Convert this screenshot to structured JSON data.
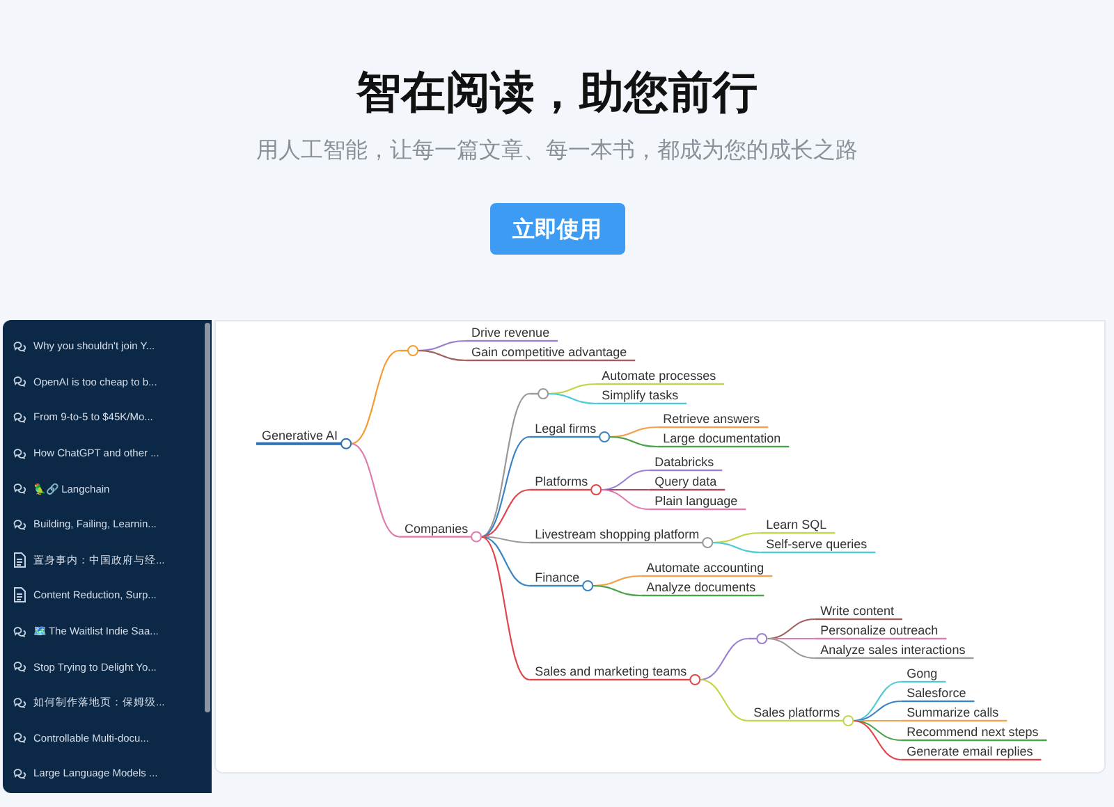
{
  "hero": {
    "title": "智在阅读，助您前行",
    "subtitle": "用人工智能，让每一篇文章、每一本书，都成为您的成长之路",
    "button": "立即使用"
  },
  "sidebar": {
    "items": [
      {
        "kind": "chat",
        "title": "Why you shouldn't join Y..."
      },
      {
        "kind": "chat",
        "title": "OpenAI is too cheap to b..."
      },
      {
        "kind": "chat",
        "title": "From 9-to-5 to $45K/Mo..."
      },
      {
        "kind": "chat",
        "title": "How ChatGPT and other ..."
      },
      {
        "kind": "chat",
        "title": "🦜🔗 Langchain"
      },
      {
        "kind": "chat",
        "title": "Building, Failing, Learnin..."
      },
      {
        "kind": "document",
        "title": "置身事内：中国政府与经..."
      },
      {
        "kind": "document",
        "title": "Content Reduction, Surp..."
      },
      {
        "kind": "chat",
        "title": "🗺️ The Waitlist Indie Saa..."
      },
      {
        "kind": "chat",
        "title": "Stop Trying to Delight Yo..."
      },
      {
        "kind": "chat",
        "title": "如何制作落地页：保姆级..."
      },
      {
        "kind": "chat",
        "title": "Controllable Multi-docu..."
      },
      {
        "kind": "chat",
        "title": "Large Language Models ..."
      }
    ]
  },
  "mindmap": {
    "root": {
      "label": "Generative AI",
      "color": "#2f6fb0",
      "children": [
        {
          "color": "#f39c34",
          "children": [
            {
              "label": "Drive revenue",
              "color": "#9b7fd0"
            },
            {
              "label": "Gain competitive advantage",
              "color": "#a0605c"
            }
          ]
        },
        {
          "label": "Companies",
          "color": "#e07bb0",
          "children": [
            {
              "color": "#999999",
              "children": [
                {
                  "label": "Automate processes",
                  "color": "#c5d54a"
                },
                {
                  "label": "Simplify tasks",
                  "color": "#4ecbd6"
                }
              ]
            },
            {
              "label": "Legal firms",
              "color": "#3a84c4",
              "children": [
                {
                  "label": "Retrieve answers",
                  "color": "#f5a04a"
                },
                {
                  "label": "Large documentation",
                  "color": "#4aa34a"
                }
              ]
            },
            {
              "label": "Platforms",
              "color": "#e0474c",
              "children": [
                {
                  "label": "Databricks",
                  "color": "#9b7fd0"
                },
                {
                  "label": "Query data",
                  "color": "#b0465a"
                },
                {
                  "label": "Plain language",
                  "color": "#e07bb0"
                }
              ]
            },
            {
              "label": "Livestream shopping platform",
              "color": "#999999",
              "children": [
                {
                  "label": "Learn SQL",
                  "color": "#c5d54a"
                },
                {
                  "label": "Self-serve queries",
                  "color": "#4ecbd6"
                }
              ]
            },
            {
              "label": "Finance",
              "color": "#3a84c4",
              "children": [
                {
                  "label": "Automate accounting",
                  "color": "#f5a04a"
                },
                {
                  "label": "Analyze documents",
                  "color": "#4aa34a"
                }
              ]
            },
            {
              "label": "Sales and marketing teams",
              "color": "#e0474c",
              "children": [
                {
                  "color": "#9b7fd0",
                  "children": [
                    {
                      "label": "Write content",
                      "color": "#a0605c"
                    },
                    {
                      "label": "Personalize outreach",
                      "color": "#e07bb0"
                    },
                    {
                      "label": "Analyze sales interactions",
                      "color": "#999999"
                    }
                  ]
                },
                {
                  "label": "Sales platforms",
                  "color": "#c5d54a",
                  "children": [
                    {
                      "label": "Gong",
                      "color": "#4ecbd6"
                    },
                    {
                      "label": "Salesforce",
                      "color": "#3a84c4"
                    },
                    {
                      "label": "Summarize calls",
                      "color": "#f5a04a"
                    },
                    {
                      "label": "Recommend next steps",
                      "color": "#4aa34a"
                    },
                    {
                      "label": "Generate email replies",
                      "color": "#e0474c"
                    }
                  ]
                }
              ]
            }
          ]
        }
      ]
    }
  }
}
